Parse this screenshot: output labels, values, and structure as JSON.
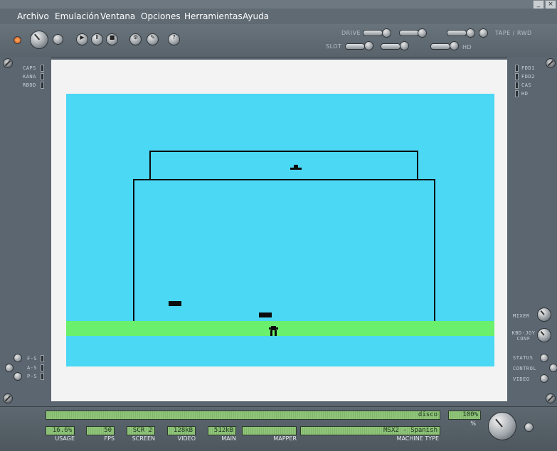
{
  "menubar": {
    "items": [
      "Archivo",
      "Emulación",
      "Ventana",
      "Opciones",
      "Herramientas",
      "Ayuda"
    ]
  },
  "window_controls": {
    "minimize": "_",
    "close": "×"
  },
  "toolbar": {
    "drive_label": "DRIVE",
    "slot_label": "SLOT",
    "tape_label": "TAPE / RWD",
    "hd_label": "HD"
  },
  "left_leds": [
    "CAPS",
    "KANA",
    "RBOD"
  ],
  "right_leds": [
    "FDD1",
    "FDD2",
    "CAS",
    "HD"
  ],
  "left_bottom_leds": [
    "F-S",
    "A-S",
    "P-S"
  ],
  "right_controls": [
    "MIXER",
    "KBD-JOY CONF",
    "STATUS",
    "CONTROL",
    "VIDEO"
  ],
  "status": {
    "message": "disco",
    "volume_value": "100%",
    "volume_unit": "%",
    "usage_value": "16.6%",
    "usage_label": "USAGE",
    "fps_value": "50",
    "fps_label": "FPS",
    "screen_value": "SCR 2",
    "screen_label": "SCREEN",
    "video_value": "128kB",
    "video_label": "VIDEO",
    "main_value": "512kB",
    "main_label": "MAIN",
    "mapper_value": "",
    "mapper_label": "MAPPER",
    "machine_value": "MSX2 - Spanish",
    "machine_label": "MACHINE TYPE"
  },
  "colors": {
    "screen_bg": "#4ad8f4",
    "grass": "#6af06c",
    "lcd": "#8fc47a",
    "chrome": "#5b6670"
  }
}
